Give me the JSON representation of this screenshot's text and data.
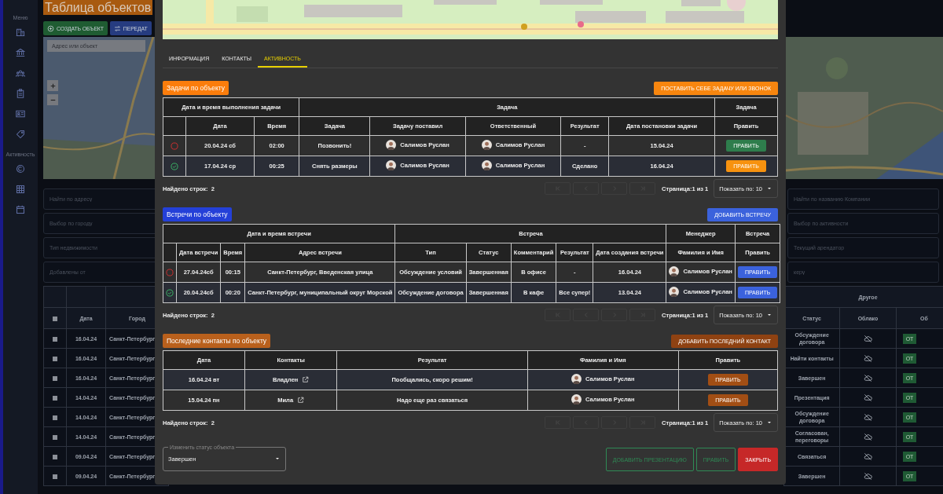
{
  "sidebar": {
    "sections": [
      {
        "label": "Меню"
      },
      {
        "label": "Активность"
      }
    ]
  },
  "page_title": "Таблица объектов",
  "toolbar": [
    {
      "label": "СОЗДАТЬ ОБЪЕКТ",
      "kind": "create",
      "color": "#1f5c32"
    },
    {
      "label": "ПЕРЕДАТ",
      "kind": "transfer",
      "color": "#263c80"
    }
  ],
  "map_search": {
    "placeholder": "Адрес или объект"
  },
  "filters_left": [
    {
      "placeholder": "Найти по адресу"
    },
    {
      "placeholder": "Выбор по городу"
    },
    {
      "placeholder": "Тип недвижимости"
    },
    {
      "placeholder": "Добавлены от"
    }
  ],
  "filters_right": [
    {
      "placeholder": "Найти по названию Компании"
    },
    {
      "placeholder": "Выбор по активности"
    },
    {
      "placeholder": "Текущий арендатор"
    },
    {
      "placeholder": "керу"
    }
  ],
  "objects_table": {
    "left_columns": [
      {
        "kind": "checkbox",
        "checked": false
      },
      {
        "label": "Дата"
      },
      {
        "label": "Город"
      }
    ],
    "right_group": "Другое",
    "right_columns": [
      {
        "label": "Статус"
      },
      {
        "label": "Облако"
      },
      {
        "label": "Об"
      }
    ],
    "rows": [
      {
        "checked": false,
        "date": "16.04.24",
        "city": "Санкт-Петербург",
        "status": "Обсуждение договора",
        "action": "ОТ"
      },
      {
        "checked": false,
        "date": "16.04.24",
        "city": "Санкт-Петербург",
        "status": "Найти контакты",
        "action": "ОТ"
      },
      {
        "checked": false,
        "date": "16.04.24",
        "city": "Санкт-Петербург",
        "status": "Завершен",
        "action": "ОТ"
      },
      {
        "checked": false,
        "date": "14.04.24",
        "city": "Санкт-Петербург",
        "status": "Презентация",
        "action": "ОТ"
      },
      {
        "checked": false,
        "date": "14.04.24",
        "city": "Санкт-Петербург",
        "status": "Обсуждение договора",
        "action": "ОТ"
      },
      {
        "checked": false,
        "date": "14.04.24",
        "city": "Санкт-Петербург",
        "status": "Согласован, переговоры",
        "action": "ОТ"
      },
      {
        "checked": false,
        "date": "09.04.24",
        "city": "Санкт-Петербург",
        "status": "Связаться",
        "action": "ОТ"
      },
      {
        "checked": false,
        "date": "09.04.24",
        "city": "Санкт-Петербург",
        "status": "Завершен",
        "action": "ОТ"
      }
    ]
  },
  "modal": {
    "tabs": [
      {
        "label": "ИНФОРМАЦИЯ",
        "selected": false
      },
      {
        "label": "КОНТАКТЫ",
        "selected": false
      },
      {
        "label": "АКТИВНОСТЬ",
        "selected": true
      }
    ],
    "sections": [
      {
        "title": "Задачи по объекту",
        "color": "#fb7d0c",
        "action": {
          "label": "ПОСТАВИТЬ СЕБЕ ЗАДАЧУ ИЛИ ЗВОНОК",
          "color": "#f7860f"
        },
        "table": {
          "groups": [
            {
              "label": "Дата и время выполнения задачи",
              "columns": [
                {
                  "kind": "status"
                },
                {
                  "label": "Дата"
                },
                {
                  "label": "Время"
                }
              ]
            },
            {
              "label": "Задача",
              "columns": [
                {
                  "label": "Задача"
                },
                {
                  "label": "Задачу поставил"
                },
                {
                  "label": "Ответственный"
                },
                {
                  "label": "Результат"
                },
                {
                  "label": "Дата постановки задачи"
                }
              ]
            },
            {
              "label": "Задача",
              "columns": [
                {
                  "label": "Править"
                }
              ]
            }
          ],
          "rows": [
            {
              "cells": [
                {
                  "kind": "status",
                  "done": false
                },
                {
                  "kind": "text",
                  "text": "20.04.24  сб"
                },
                {
                  "kind": "text",
                  "text": "02:00"
                },
                {
                  "kind": "text",
                  "text": "Позвонить!"
                },
                {
                  "kind": "person",
                  "text": "Салимов Руслан"
                },
                {
                  "kind": "person",
                  "text": "Салимов Руслан"
                },
                {
                  "kind": "text",
                  "text": "-"
                },
                {
                  "kind": "text",
                  "text": "15.04.24"
                },
                {
                  "kind": "button",
                  "label": "ПРАВИТЬ",
                  "color": "#2e7d4c"
                }
              ]
            },
            {
              "cells": [
                {
                  "kind": "status",
                  "done": true
                },
                {
                  "kind": "text",
                  "text": "17.04.24  ср"
                },
                {
                  "kind": "text",
                  "text": "00:25"
                },
                {
                  "kind": "text",
                  "text": "Снять размеры"
                },
                {
                  "kind": "person",
                  "text": "Салимов Руслан"
                },
                {
                  "kind": "person",
                  "text": "Салимов Руслан"
                },
                {
                  "kind": "text",
                  "text": "Сделано"
                },
                {
                  "kind": "text",
                  "text": "16.04.24"
                },
                {
                  "kind": "button",
                  "label": "ПРАВИТЬ",
                  "color": "#f7920f"
                }
              ]
            }
          ]
        },
        "pager": {
          "found": "Найдено строк:  2",
          "nav_disabled": true,
          "page": "Страница:1 из 1",
          "page_size": "Показать по: 10"
        }
      },
      {
        "title": "Встречи по объекту",
        "color": "#2440d8",
        "action": {
          "label": "ДОБАВИТЬ ВСТРЕЧУ",
          "color": "#3b62dc"
        },
        "table": {
          "groups": [
            {
              "label": "Дата и время встречи",
              "columns": [
                {
                  "kind": "status"
                },
                {
                  "label": "Дата встречи"
                },
                {
                  "label": "Время"
                },
                {
                  "label": "Адрес встречи"
                }
              ]
            },
            {
              "label": "Встреча",
              "columns": [
                {
                  "label": "Тип"
                },
                {
                  "label": "Статус"
                },
                {
                  "label": "Комментарий"
                },
                {
                  "label": "Результат"
                },
                {
                  "label": "Дата создания встречи"
                }
              ]
            },
            {
              "label": "Менеджер",
              "columns": [
                {
                  "label": "Фамилия и Имя"
                }
              ]
            },
            {
              "label": "Встреча",
              "columns": [
                {
                  "label": "Править"
                }
              ]
            }
          ],
          "rows": [
            {
              "cells": [
                {
                  "kind": "status",
                  "done": false
                },
                {
                  "kind": "text",
                  "text": "27.04.24сб"
                },
                {
                  "kind": "text",
                  "text": "00:15"
                },
                {
                  "kind": "text",
                  "text": "Санкт-Петербург, Введенская улица"
                },
                {
                  "kind": "text",
                  "text": "Обсуждение условий"
                },
                {
                  "kind": "text",
                  "text": "Завершенная"
                },
                {
                  "kind": "text",
                  "text": "В офисе"
                },
                {
                  "kind": "text",
                  "text": "-"
                },
                {
                  "kind": "text",
                  "text": "16.04.24"
                },
                {
                  "kind": "person",
                  "text": "Салимов Руслан"
                },
                {
                  "kind": "button",
                  "label": "ПРАВИТЬ",
                  "color": "#3b62dc"
                }
              ]
            },
            {
              "cells": [
                {
                  "kind": "status",
                  "done": true
                },
                {
                  "kind": "text",
                  "text": "20.04.24сб"
                },
                {
                  "kind": "text",
                  "text": "00:20"
                },
                {
                  "kind": "text",
                  "text": "Санкт-Петербург, муниципальный округ Морской"
                },
                {
                  "kind": "text",
                  "text": "Обсуждение договора"
                },
                {
                  "kind": "text",
                  "text": "Завершенная"
                },
                {
                  "kind": "text",
                  "text": "В кафе"
                },
                {
                  "kind": "text",
                  "text": "Все супер!"
                },
                {
                  "kind": "text",
                  "text": "13.04.24"
                },
                {
                  "kind": "person",
                  "text": "Салимов Руслан"
                },
                {
                  "kind": "button",
                  "label": "ПРАВИТЬ",
                  "color": "#3b62dc"
                }
              ]
            }
          ]
        },
        "pager": {
          "found": "Найдено строк:  2",
          "nav_disabled": true,
          "page": "Страница:1 из 1",
          "page_size": "Показать по: 10"
        }
      },
      {
        "title": "Последние контакты по объекту",
        "color": "#b9601c",
        "action": {
          "label": "ДОБАВИТЬ ПОСЛЕДНИЙ КОНТАКТ",
          "color": "#8f4212"
        },
        "table": {
          "columns": [
            {
              "label": "Дата"
            },
            {
              "label": "Контакты"
            },
            {
              "label": "Результат"
            },
            {
              "label": "Фамилия и Имя"
            },
            {
              "label": "Править"
            }
          ],
          "rows": [
            {
              "cells": [
                {
                  "kind": "text",
                  "text": "16.04.24  вт"
                },
                {
                  "kind": "link",
                  "text": "Владлен"
                },
                {
                  "kind": "text",
                  "text": "Пообщались, скоро решим!"
                },
                {
                  "kind": "person",
                  "text": "Салимов Руслан"
                },
                {
                  "kind": "button",
                  "label": "ПРАВИТЬ",
                  "color": "#a24e14"
                }
              ]
            },
            {
              "cells": [
                {
                  "kind": "text",
                  "text": "15.04.24  пн"
                },
                {
                  "kind": "link",
                  "text": "Мила"
                },
                {
                  "kind": "text",
                  "text": "Надо еще раз связаться"
                },
                {
                  "kind": "person",
                  "text": "Салимов Руслан"
                },
                {
                  "kind": "button",
                  "label": "ПРАВИТЬ",
                  "color": "#a24e14"
                }
              ]
            }
          ]
        },
        "pager": {
          "found": "Найдено строк:  2",
          "nav_disabled": true,
          "page": "Страница:1 из 1",
          "page_size": "Показать по: 10"
        }
      }
    ],
    "status_select": {
      "label": "Изменить статус объекта",
      "value": "Завершен"
    },
    "footer_buttons": [
      {
        "label": "ДОБАВИТЬ ПРЕЗЕНТАЦИЮ",
        "kind": "outlined",
        "color": "#2f8a55"
      },
      {
        "label": "ПРАВИТЬ",
        "kind": "outlined",
        "color": "#2f8a55"
      },
      {
        "label": "ЗАКРЫТЬ",
        "kind": "filled",
        "color": "#c62828"
      }
    ]
  }
}
